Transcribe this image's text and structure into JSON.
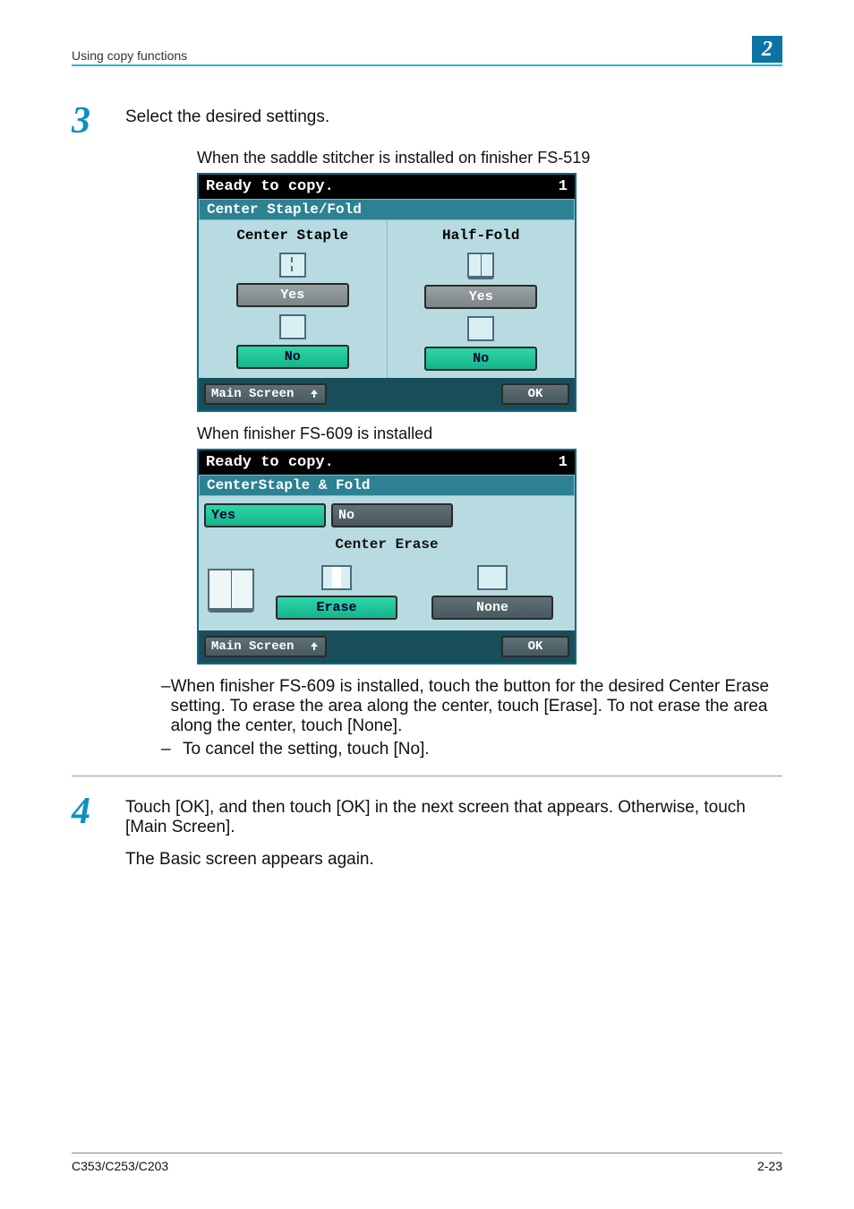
{
  "header": {
    "section": "Using copy functions",
    "chapter": "2"
  },
  "step3": {
    "num": "3",
    "text": "Select the desired settings.",
    "caption_a": "When the saddle stitcher is installed on finisher FS-519",
    "screen_a": {
      "status": "Ready to copy.",
      "count": "1",
      "title": "Center Staple/Fold",
      "left_head": "Center Staple",
      "right_head": "Half-Fold",
      "yes": "Yes",
      "no": "No",
      "main": "Main Screen",
      "ok": "OK"
    },
    "caption_b": "When finisher FS-609 is installed",
    "screen_b": {
      "status": "Ready to copy.",
      "count": "1",
      "title": "CenterStaple & Fold",
      "yes": "Yes",
      "no": "No",
      "ce_head": "Center Erase",
      "erase": "Erase",
      "none": "None",
      "main": "Main Screen",
      "ok": "OK"
    },
    "bullets": {
      "b1": "When finisher FS-609 is installed, touch the button for the desired Center Erase setting. To erase the area along the center, touch [Erase]. To not erase the area along the center, touch [None].",
      "b2": "To cancel the setting, touch [No]."
    }
  },
  "step4": {
    "num": "4",
    "text": "Touch [OK], and then touch [OK] in the next screen that appears. Otherwise, touch [Main Screen].",
    "result": "The Basic screen appears again."
  },
  "footer": {
    "model": "C353/C253/C203",
    "page": "2-23"
  }
}
